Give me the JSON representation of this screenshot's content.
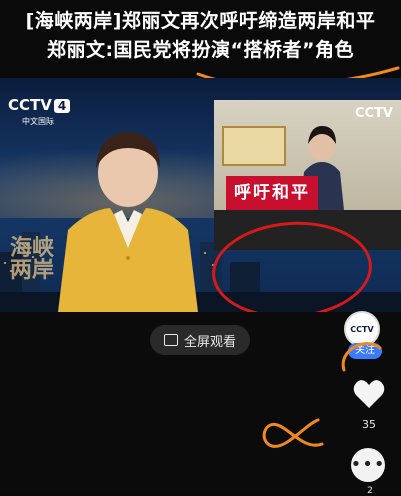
{
  "headline": {
    "line1": "[海峡两岸]郑丽文再次呼吁缔造两岸和平",
    "line2": "郑丽文:国民党将扮演“搭桥者”角色"
  },
  "video": {
    "channel": "CCTV",
    "channel_number": "4",
    "channel_sub": "中文国际",
    "program_watermark": "海峡\n两岸",
    "inset_watermark": "CCTV",
    "inset_banner": "呼吁和平"
  },
  "controls": {
    "fullscreen_label": "全屏观看"
  },
  "sidebar": {
    "avatar_text": "CCTV",
    "follow_label": "关注",
    "like_count": "35",
    "more_count": "2"
  },
  "colors": {
    "annotation_red": "#d41b1b",
    "annotation_orange": "#f08a1c",
    "follow_blue": "#3b7cff"
  },
  "icons": [
    "fullscreen-icon",
    "heart-icon",
    "more-dots-icon"
  ]
}
